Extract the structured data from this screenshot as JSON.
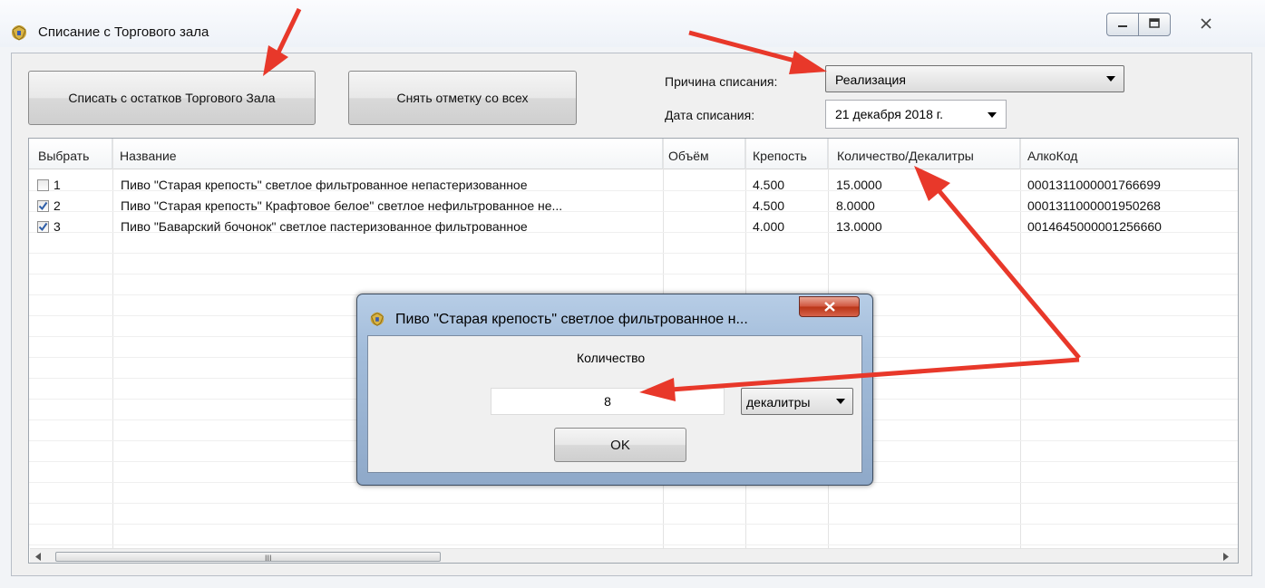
{
  "window": {
    "title": "Списание с Торгового зала"
  },
  "toolbar": {
    "writeoff_label": "Списать с остатков Торгового Зала",
    "uncheck_label": "Снять отметку со всех"
  },
  "form": {
    "reason_label": "Причина списания:",
    "reason_value": "Реализация",
    "date_label": "Дата списания:",
    "date_value": "21 декабря  2018 г."
  },
  "grid": {
    "columns": [
      "Выбрать",
      "Название",
      "Объём",
      "Крепость",
      "Количество/Декалитры",
      "АлкоКод"
    ],
    "rows": [
      {
        "checked": false,
        "num": "1",
        "name": "Пиво \"Старая крепость\" светлое фильтрованное непастеризованное",
        "volume": "",
        "strength": "4.500",
        "quantity": "15.0000",
        "alcocode": "0001311000001766699"
      },
      {
        "checked": true,
        "num": "2",
        "name": "Пиво \"Старая крепость\" Крафтовое белое\" светлое нефильтрованное не...",
        "volume": "",
        "strength": "4.500",
        "quantity": "8.0000",
        "alcocode": "0001311000001950268"
      },
      {
        "checked": true,
        "num": "3",
        "name": "Пиво \"Баварский бочонок\" светлое пастеризованное фильтрованное",
        "volume": "",
        "strength": "4.000",
        "quantity": "13.0000",
        "alcocode": "0014645000001256660"
      }
    ],
    "scroll_grip": "III"
  },
  "dialog": {
    "title": "Пиво \"Старая крепость\" светлое фильтрованное н...",
    "quantity_label": "Количество",
    "quantity_value": "8",
    "unit_value": "декалитры",
    "ok_label": "OK"
  },
  "colors": {
    "annotation_arrow": "#e8382a",
    "dialog_frame": "#a2bcda",
    "checkbox_check": "#2f5fa8"
  }
}
